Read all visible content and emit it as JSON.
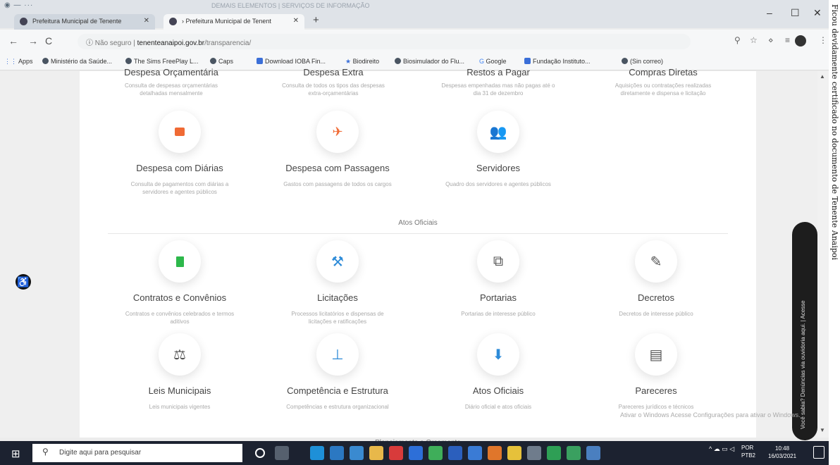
{
  "browser": {
    "window_title": "DEMAIS ELEMENTOS | SERVIÇOS DE INFORMAÇÃO",
    "tabs": [
      {
        "label": "Prefeitura Municipal de Tenente",
        "active": false
      },
      {
        "label": "› Prefeitura Municipal de Tenent",
        "active": true
      }
    ],
    "new_tab": "+",
    "window_controls": {
      "minimize": "–",
      "maximize": "☐",
      "close": "✕"
    },
    "nav": {
      "back": "←",
      "forward": "→",
      "reload": "C"
    },
    "address": {
      "security": "Não seguro",
      "separator": "|",
      "host": "tenenteanaipoi.gov.br",
      "path": "/transparencia/"
    },
    "toolbar_icons": [
      "zoom-icon",
      "star-icon",
      "extension-icon",
      "reading-list-icon",
      "profile-avatar",
      "menu-icon"
    ],
    "bookmarks": [
      {
        "label": "Apps"
      },
      {
        "label": "Ministério da Saúde..."
      },
      {
        "label": "The Sims FreePlay L..."
      },
      {
        "label": "Caps"
      },
      {
        "label": "Download IOBA Fin..."
      },
      {
        "label": "Biodireito"
      },
      {
        "label": "Biosimulador do Flu..."
      },
      {
        "label": "Google"
      },
      {
        "label": "Fundação Instituto..."
      },
      {
        "label": "(Sin correo)"
      }
    ]
  },
  "page": {
    "top_row": [
      {
        "title": "Despesa Orçamentária",
        "desc": "Consulta de despesas orçamentárias detalhadas mensalmente"
      },
      {
        "title": "Despesa Extra",
        "desc": "Consulta de todos os tipos das despesas extra-orçamentárias"
      },
      {
        "title": "Restos a Pagar",
        "desc": "Despesas empenhadas mas não pagas até o dia 31 de dezembro"
      },
      {
        "title": "Compras Diretas",
        "desc": "Aquisições ou contratações realizadas diretamente e dispensa e licitação"
      }
    ],
    "expense_row": [
      {
        "title": "Despesa com Diárias",
        "desc": "Consulta de pagamentos com diárias a servidores e agentes públicos",
        "icon": "wallet-icon"
      },
      {
        "title": "Despesa com Passagens",
        "desc": "Gastos com passagens de todos os cargos",
        "icon": "airplane-icon"
      },
      {
        "title": "Servidores",
        "desc": "Quadro dos servidores e agentes públicos",
        "icon": "people-icon"
      }
    ],
    "section_title": "Atos Oficiais",
    "acts_row1": [
      {
        "title": "Contratos e Convênios",
        "desc": "Contratos e convênios celebrados e termos aditivos",
        "icon": "document-icon"
      },
      {
        "title": "Licitações",
        "desc": "Processos licitatórios e dispensas de licitações e ratificações",
        "icon": "gavel-icon"
      },
      {
        "title": "Portarias",
        "desc": "Portarias de interesse público",
        "icon": "copy-icon"
      },
      {
        "title": "Decretos",
        "desc": "Decretos de interesse público",
        "icon": "edit-icon"
      }
    ],
    "acts_row2": [
      {
        "title": "Leis Municipais",
        "desc": "Leis municipais vigentes",
        "icon": "scales-icon"
      },
      {
        "title": "Competência e Estrutura",
        "desc": "Competências e estrutura organizacional",
        "icon": "org-chart-icon"
      },
      {
        "title": "Atos Oficiais",
        "desc": "Diário oficial e atos oficiais",
        "icon": "download-icon"
      },
      {
        "title": "Pareceres",
        "desc": "Pareceres jurídicos e técnicos",
        "icon": "file-icon"
      }
    ],
    "bottom_cut_text": "Planejamento e Orçamento",
    "accessibility_badge": "♿",
    "feedback_tab": "Você sabia? Denúncias via ouvidoria aqui. | Acesse",
    "windows_watermark": "Ativar o Windows  Acesse Configurações para ativar o Windows."
  },
  "taskbar": {
    "search_placeholder": "Digite aqui para pesquisar",
    "tray": {
      "lang": "POR",
      "layout": "PTB2",
      "time": "10:48",
      "date": "16/03/2021"
    }
  },
  "side_text": "Ficou devidamente certificado no documento de Tenente Anaipoi"
}
